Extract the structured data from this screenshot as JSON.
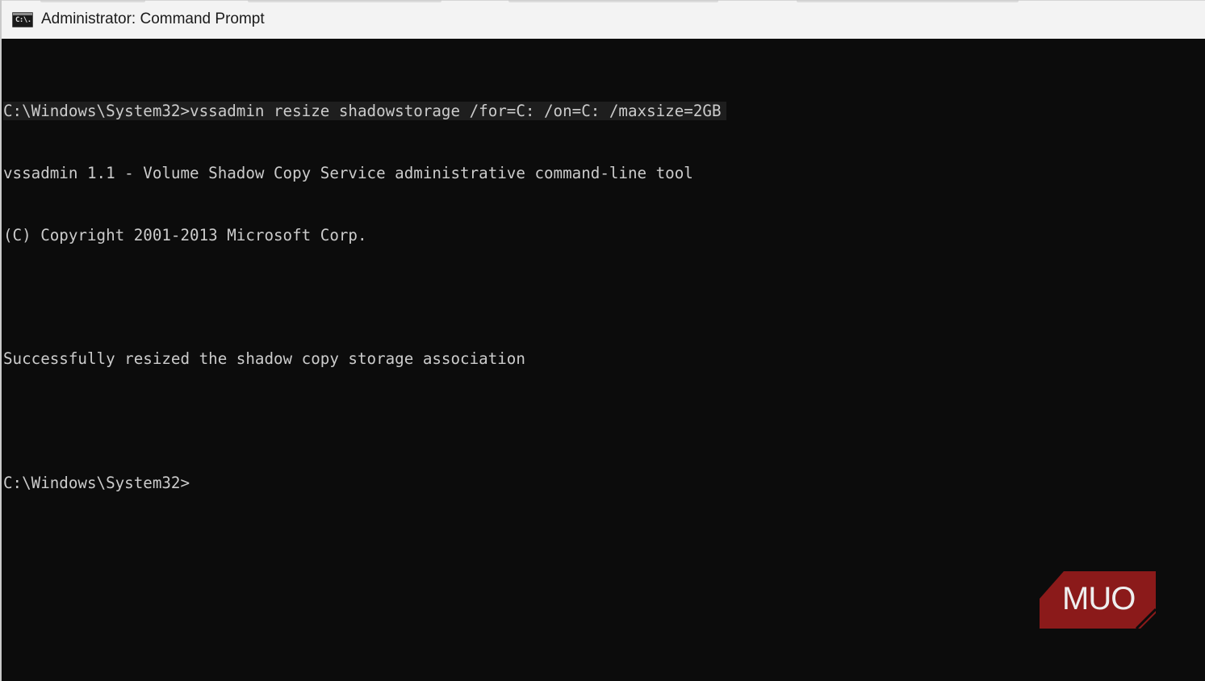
{
  "window": {
    "title": "Administrator: Command Prompt",
    "icon": "cmd-icon",
    "icon_glyph": "C:\\."
  },
  "console": {
    "lines": [
      "C:\\Windows\\System32>vssadmin resize shadowstorage /for=C: /on=C: /maxsize=2GB",
      "vssadmin 1.1 - Volume Shadow Copy Service administrative command-line tool",
      "(C) Copyright 2001-2013 Microsoft Corp.",
      "",
      "Successfully resized the shadow copy storage association",
      "",
      "C:\\Windows\\System32>"
    ]
  },
  "watermark": {
    "text": "MUO",
    "color": "#8b1a1a"
  },
  "colors": {
    "console_bg": "#0c0c0c",
    "console_fg": "#cccccc",
    "titlebar_bg": "#f3f3f3"
  }
}
